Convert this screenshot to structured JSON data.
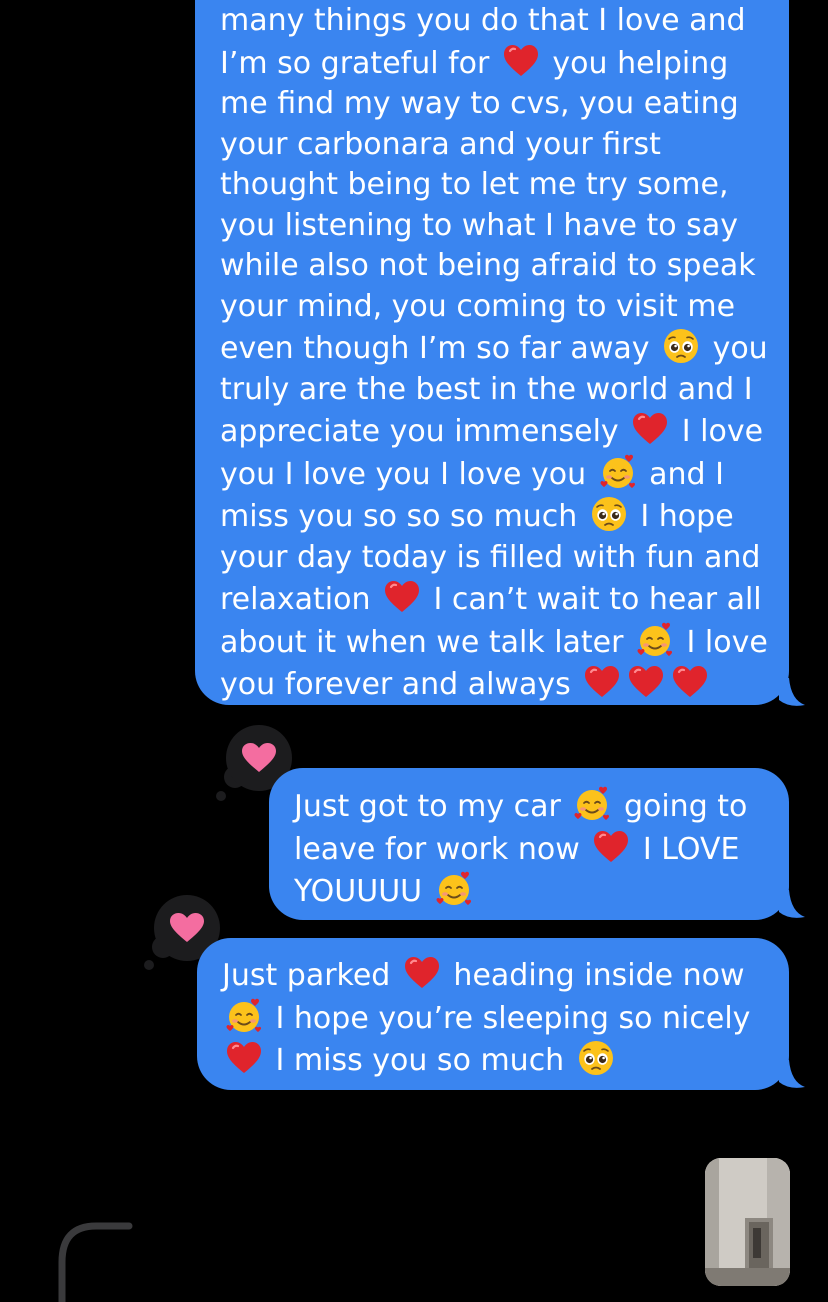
{
  "messages": [
    {
      "id": "msg1",
      "lines": [
        [
          {
            "t": "many things you do that I love and"
          }
        ],
        [
          {
            "t": "I’m so grateful for "
          },
          {
            "e": "red-heart"
          },
          {
            "t": " you helping"
          }
        ],
        [
          {
            "t": "me find my way to cvs, you eating"
          }
        ],
        [
          {
            "t": "your carbonara and your first"
          }
        ],
        [
          {
            "t": "thought being to let me try some,"
          }
        ],
        [
          {
            "t": "you listening to what I have to say"
          }
        ],
        [
          {
            "t": "while also not being afraid to speak"
          }
        ],
        [
          {
            "t": "your mind, you coming to visit me"
          }
        ],
        [
          {
            "t": "even though I’m so far away "
          },
          {
            "e": "pleading-face"
          },
          {
            "t": " you"
          }
        ],
        [
          {
            "t": "truly are the best in the world and I"
          }
        ],
        [
          {
            "t": "appreciate you immensely "
          },
          {
            "e": "red-heart"
          },
          {
            "t": " I love"
          }
        ],
        [
          {
            "t": "you I love you I love you "
          },
          {
            "e": "smiling-face-with-hearts"
          },
          {
            "t": " and I"
          }
        ],
        [
          {
            "t": "miss you so so so much "
          },
          {
            "e": "pleading-face"
          },
          {
            "t": " I hope"
          }
        ],
        [
          {
            "t": "your day today is filled with fun and"
          }
        ],
        [
          {
            "t": "relaxation "
          },
          {
            "e": "red-heart"
          },
          {
            "t": " I can’t wait to hear all"
          }
        ],
        [
          {
            "t": "about it when we talk later "
          },
          {
            "e": "smiling-face-with-hearts"
          },
          {
            "t": " I love"
          }
        ],
        [
          {
            "t": "you forever and always "
          },
          {
            "e": "red-heart"
          },
          {
            "e": "red-heart"
          },
          {
            "e": "red-heart"
          }
        ]
      ]
    },
    {
      "id": "msg2",
      "lines": [
        [
          {
            "t": "Just got to my car "
          },
          {
            "e": "smiling-face-with-hearts"
          },
          {
            "t": " going to"
          }
        ],
        [
          {
            "t": "leave for work now "
          },
          {
            "e": "red-heart"
          },
          {
            "t": " I LOVE"
          }
        ],
        [
          {
            "t": "YOUUUU "
          },
          {
            "e": "smiling-face-with-hearts"
          }
        ]
      ]
    },
    {
      "id": "msg3",
      "lines": [
        [
          {
            "t": "Just parked "
          },
          {
            "e": "red-heart"
          },
          {
            "t": " heading inside now"
          }
        ],
        [
          {
            "e": "smiling-face-with-hearts"
          },
          {
            "t": " I hope you’re sleeping so nicely"
          }
        ],
        [
          {
            "e": "red-heart"
          },
          {
            "t": " I miss you so much "
          },
          {
            "e": "pleading-face"
          }
        ]
      ]
    }
  ],
  "reactions": [
    {
      "id": "reaction-1",
      "icon": "heart-reaction-icon",
      "color": "#f46da0"
    },
    {
      "id": "reaction-2",
      "icon": "heart-reaction-icon",
      "color": "#f46da0"
    }
  ],
  "colors": {
    "background": "#000000",
    "bubble": "#3a85f0",
    "text": "#ffffff",
    "tapback": "#1c1c1e"
  }
}
